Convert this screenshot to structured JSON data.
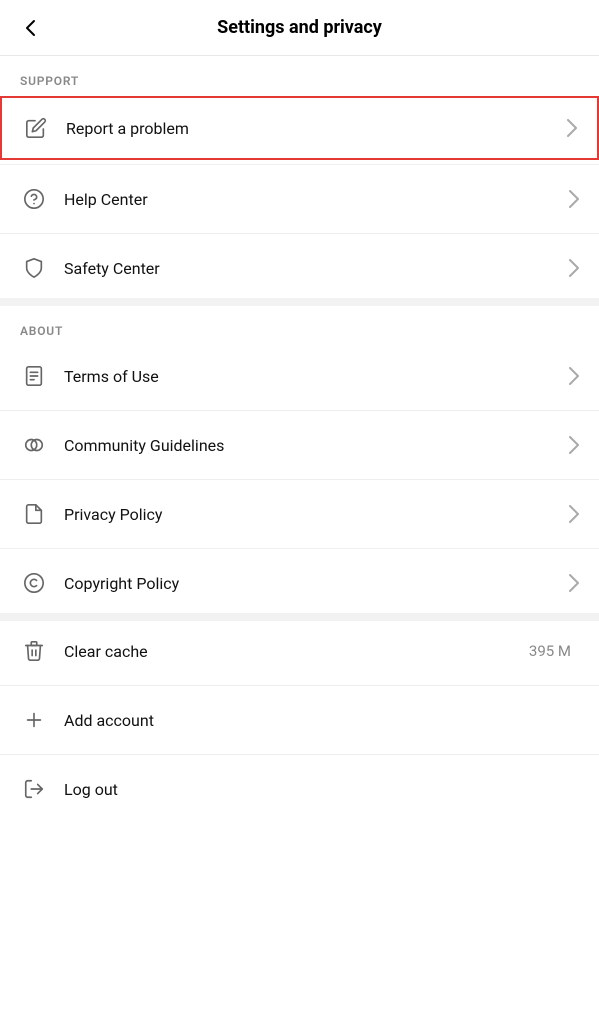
{
  "header": {
    "title": "Settings and privacy",
    "back_label": "Back"
  },
  "sections": [
    {
      "id": "support",
      "label": "SUPPORT",
      "items": [
        {
          "id": "report-problem",
          "label": "Report a problem",
          "icon": "edit",
          "highlighted": true,
          "value": ""
        },
        {
          "id": "help-center",
          "label": "Help Center",
          "icon": "help-circle",
          "highlighted": false,
          "value": ""
        },
        {
          "id": "safety-center",
          "label": "Safety Center",
          "icon": "shield",
          "highlighted": false,
          "value": ""
        }
      ]
    },
    {
      "id": "about",
      "label": "ABOUT",
      "items": [
        {
          "id": "terms-of-use",
          "label": "Terms of Use",
          "icon": "document",
          "highlighted": false,
          "value": ""
        },
        {
          "id": "community-guidelines",
          "label": "Community Guidelines",
          "icon": "circles",
          "highlighted": false,
          "value": ""
        },
        {
          "id": "privacy-policy",
          "label": "Privacy Policy",
          "icon": "file",
          "highlighted": false,
          "value": ""
        },
        {
          "id": "copyright-policy",
          "label": "Copyright Policy",
          "icon": "copyright",
          "highlighted": false,
          "value": ""
        }
      ]
    }
  ],
  "bottom_items": [
    {
      "id": "clear-cache",
      "label": "Clear cache",
      "icon": "trash",
      "value": "395 M"
    },
    {
      "id": "add-account",
      "label": "Add account",
      "icon": "plus",
      "value": ""
    },
    {
      "id": "log-out",
      "label": "Log out",
      "icon": "logout",
      "value": ""
    }
  ],
  "chevron": "›"
}
